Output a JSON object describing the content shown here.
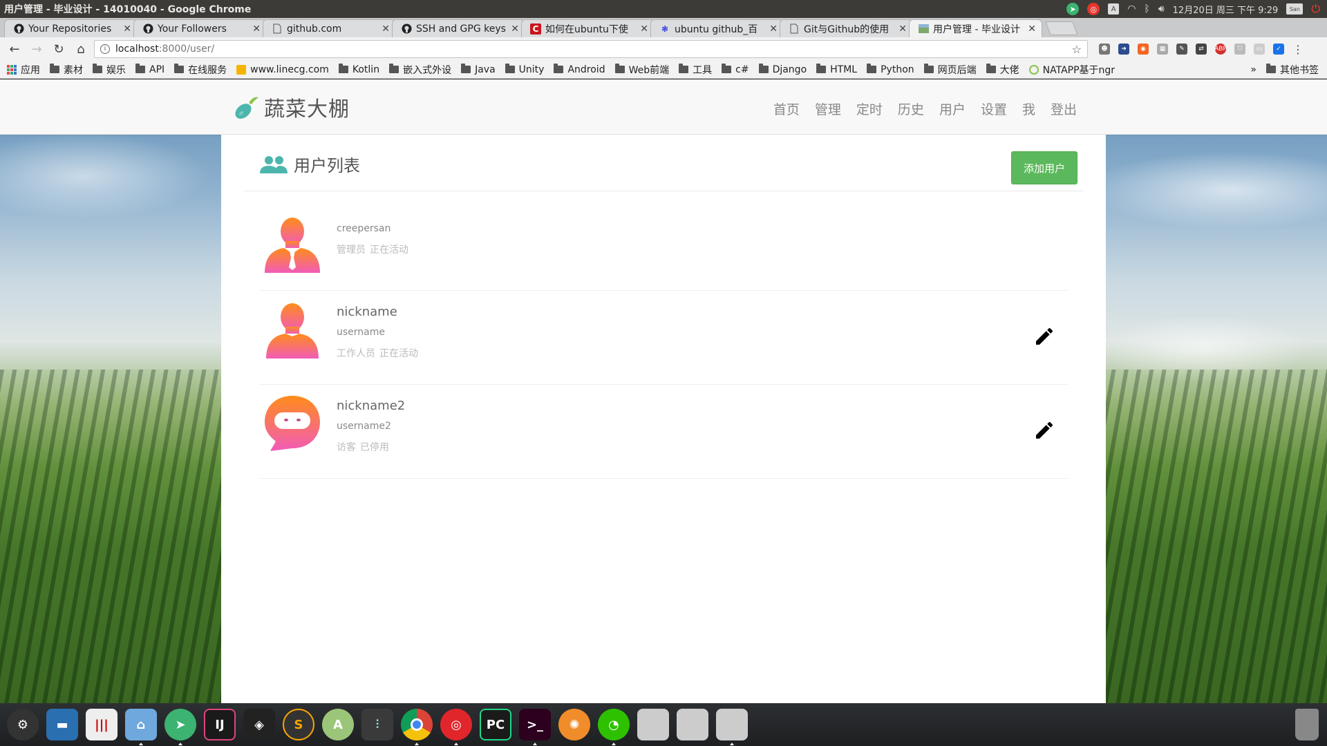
{
  "window": {
    "title": "用户管理 - 毕业设计 - 14010040 - Google Chrome"
  },
  "system_tray": {
    "clock": "12月20日 周三 下午 9:29",
    "user": "San"
  },
  "tabs": [
    {
      "label": "Your Repositories",
      "icon": "github-icon"
    },
    {
      "label": "Your Followers",
      "icon": "github-icon"
    },
    {
      "label": "github.com",
      "icon": "page-icon"
    },
    {
      "label": "SSH and GPG keys",
      "icon": "github-icon"
    },
    {
      "label": "如何在ubuntu下使",
      "icon": "csdn-icon"
    },
    {
      "label": "ubuntu github_百",
      "icon": "baidu-icon"
    },
    {
      "label": "Git与Github的使用",
      "icon": "page-icon"
    },
    {
      "label": "用户管理 - 毕业设计",
      "icon": "site-icon",
      "active": true
    }
  ],
  "address_bar": {
    "host": "localhost",
    "path": ":8000/user/"
  },
  "bookmarks": [
    "应用",
    "素材",
    "娱乐",
    "API",
    "在线服务",
    "www.linecg.com",
    "Kotlin",
    "嵌入式外设",
    "Java",
    "Unity",
    "Android",
    "Web前端",
    "工具",
    "c#",
    "Django",
    "HTML",
    "Python",
    "网页后端",
    "大佬",
    "NATAPP基于ngr"
  ],
  "bookmarks_overflow": "»",
  "bookmarks_other": "其他书签",
  "site": {
    "brand": "蔬菜大棚",
    "nav": [
      "首页",
      "管理",
      "定时",
      "历史",
      "用户",
      "设置",
      "我",
      "登出"
    ]
  },
  "page": {
    "title": "用户列表",
    "add_button": "添加用户",
    "users": [
      {
        "nickname": "",
        "username": "creepersan",
        "role": "管理员",
        "status": "正在活动",
        "avatar": "person-tie-avatar-icon",
        "editable": false
      },
      {
        "nickname": "nickname",
        "username": "username",
        "role": "工作人员",
        "status": "正在活动",
        "avatar": "person-avatar-icon",
        "editable": true
      },
      {
        "nickname": "nickname2",
        "username": "username2",
        "role": "访客",
        "status": "已停用",
        "avatar": "chat-bubble-avatar-icon",
        "editable": true
      }
    ]
  },
  "colors": {
    "accent_green": "#5cb85c",
    "brand_teal": "#4db6ac",
    "avatar_gradient_top": "#ff8c1a",
    "avatar_gradient_bottom": "#f15cb8"
  },
  "dock_apps": [
    "system-settings",
    "files-dark",
    "mixer",
    "home-folder",
    "telegram",
    "intellij",
    "unity",
    "sublime",
    "android-studio",
    "equalizer",
    "chrome",
    "netease-music",
    "pycharm",
    "terminal",
    "fish",
    "wechat",
    "drive-1",
    "drive-2",
    "drive-3",
    "trash"
  ]
}
